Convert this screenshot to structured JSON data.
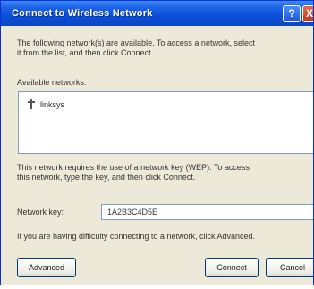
{
  "window": {
    "title": "Connect to Wireless Network",
    "help_symbol": "?",
    "close_symbol": "X"
  },
  "intro": {
    "line1": "The following network(s) are available. To access a network, select",
    "line2": "it from the list, and then click Connect."
  },
  "networks": {
    "label": "Available networks:",
    "items": [
      "linksys"
    ]
  },
  "wep_info": {
    "line1": "This network requires the use of a network key (WEP). To access",
    "line2": "this network, type the key, and then click Connect."
  },
  "key": {
    "label": "Network key:",
    "value": "1A2B3C4D5E"
  },
  "help_text": "If you are having difficulty connecting to a network, click Advanced.",
  "buttons": {
    "advanced": "Advanced",
    "connect": "Connect",
    "cancel": "Cancel"
  }
}
